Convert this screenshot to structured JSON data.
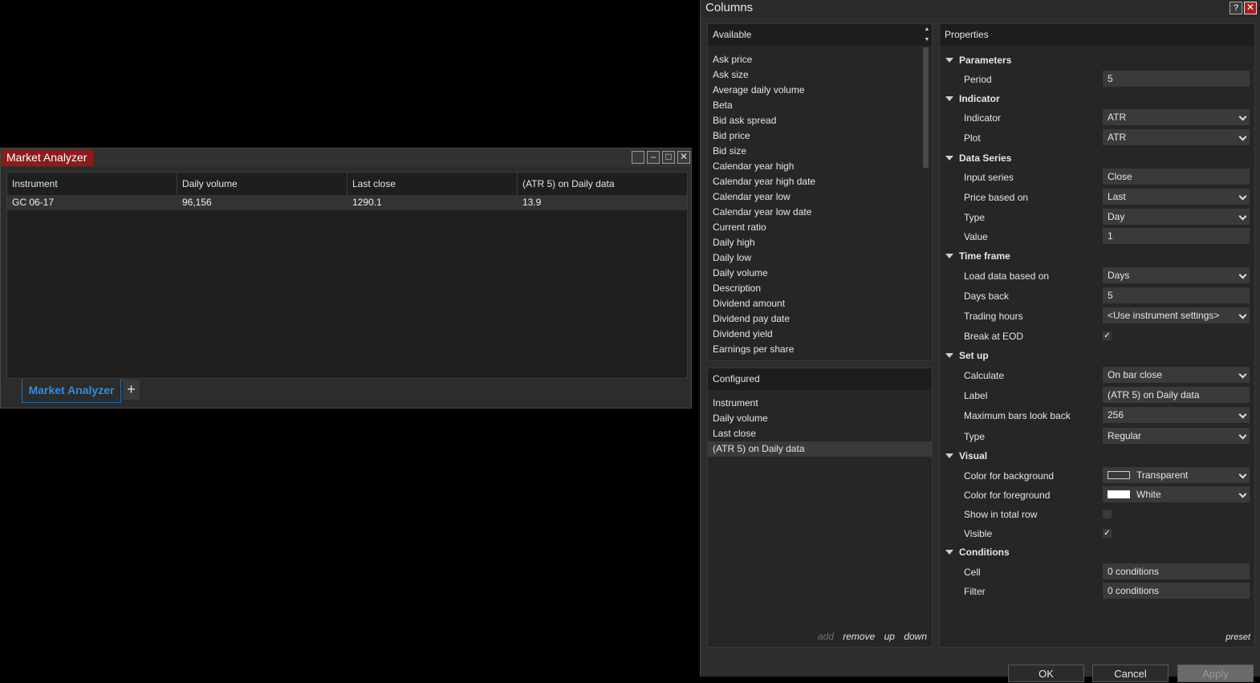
{
  "market_analyzer": {
    "title": "Market Analyzer",
    "columns": [
      "Instrument",
      "Daily volume",
      "Last close",
      "(ATR 5) on Daily data"
    ],
    "rows": [
      [
        "GC 06-17",
        "96,156",
        "1290.1",
        "13.9"
      ]
    ],
    "tab_label": "Market Analyzer",
    "add_tab": "+"
  },
  "dialog": {
    "title": "Columns",
    "help": "?",
    "close": "✕",
    "available": {
      "header": "Available",
      "items": [
        "Ask price",
        "Ask size",
        "Average daily volume",
        "Beta",
        "Bid ask spread",
        "Bid price",
        "Bid size",
        "Calendar year high",
        "Calendar year high date",
        "Calendar year low",
        "Calendar year low date",
        "Current ratio",
        "Daily high",
        "Daily low",
        "Daily volume",
        "Description",
        "Dividend amount",
        "Dividend pay date",
        "Dividend yield",
        "Earnings per share"
      ]
    },
    "configured": {
      "header": "Configured",
      "items": [
        "Instrument",
        "Daily volume",
        "Last close",
        "(ATR 5) on Daily data"
      ],
      "actions": {
        "add": "add",
        "remove": "remove",
        "up": "up",
        "down": "down"
      }
    },
    "properties": {
      "header": "Properties",
      "sections": {
        "parameters": {
          "title": "Parameters",
          "period_label": "Period",
          "period_value": "5"
        },
        "indicator": {
          "title": "Indicator",
          "indicator_label": "Indicator",
          "indicator_value": "ATR",
          "plot_label": "Plot",
          "plot_value": "ATR"
        },
        "data_series": {
          "title": "Data Series",
          "input_label": "Input series",
          "input_value": "Close",
          "price_label": "Price based on",
          "price_value": "Last",
          "type_label": "Type",
          "type_value": "Day",
          "value_label": "Value",
          "value_value": "1"
        },
        "time_frame": {
          "title": "Time frame",
          "load_label": "Load data based on",
          "load_value": "Days",
          "days_label": "Days back",
          "days_value": "5",
          "hours_label": "Trading hours",
          "hours_value": "<Use instrument settings>",
          "eod_label": "Break at EOD",
          "eod_checked": "✓"
        },
        "setup": {
          "title": "Set up",
          "calc_label": "Calculate",
          "calc_value": "On bar close",
          "label_label": "Label",
          "label_value": "(ATR 5) on Daily data",
          "maxbars_label": "Maximum bars look back",
          "maxbars_value": "256",
          "type_label": "Type",
          "type_value": "Regular"
        },
        "visual": {
          "title": "Visual",
          "bg_label": "Color for background",
          "bg_value": "Transparent",
          "fg_label": "Color for foreground",
          "fg_value": "White",
          "total_label": "Show in total row",
          "visible_label": "Visible",
          "visible_checked": "✓"
        },
        "conditions": {
          "title": "Conditions",
          "cell_label": "Cell",
          "cell_value": "0 conditions",
          "filter_label": "Filter",
          "filter_value": "0 conditions"
        }
      },
      "preset": "preset"
    },
    "buttons": {
      "ok": "OK",
      "cancel": "Cancel",
      "apply": "Apply"
    }
  },
  "colors": {
    "accent_red": "#8c1c1c",
    "tab_blue": "#2e8de0",
    "panel_bg": "#262626"
  }
}
